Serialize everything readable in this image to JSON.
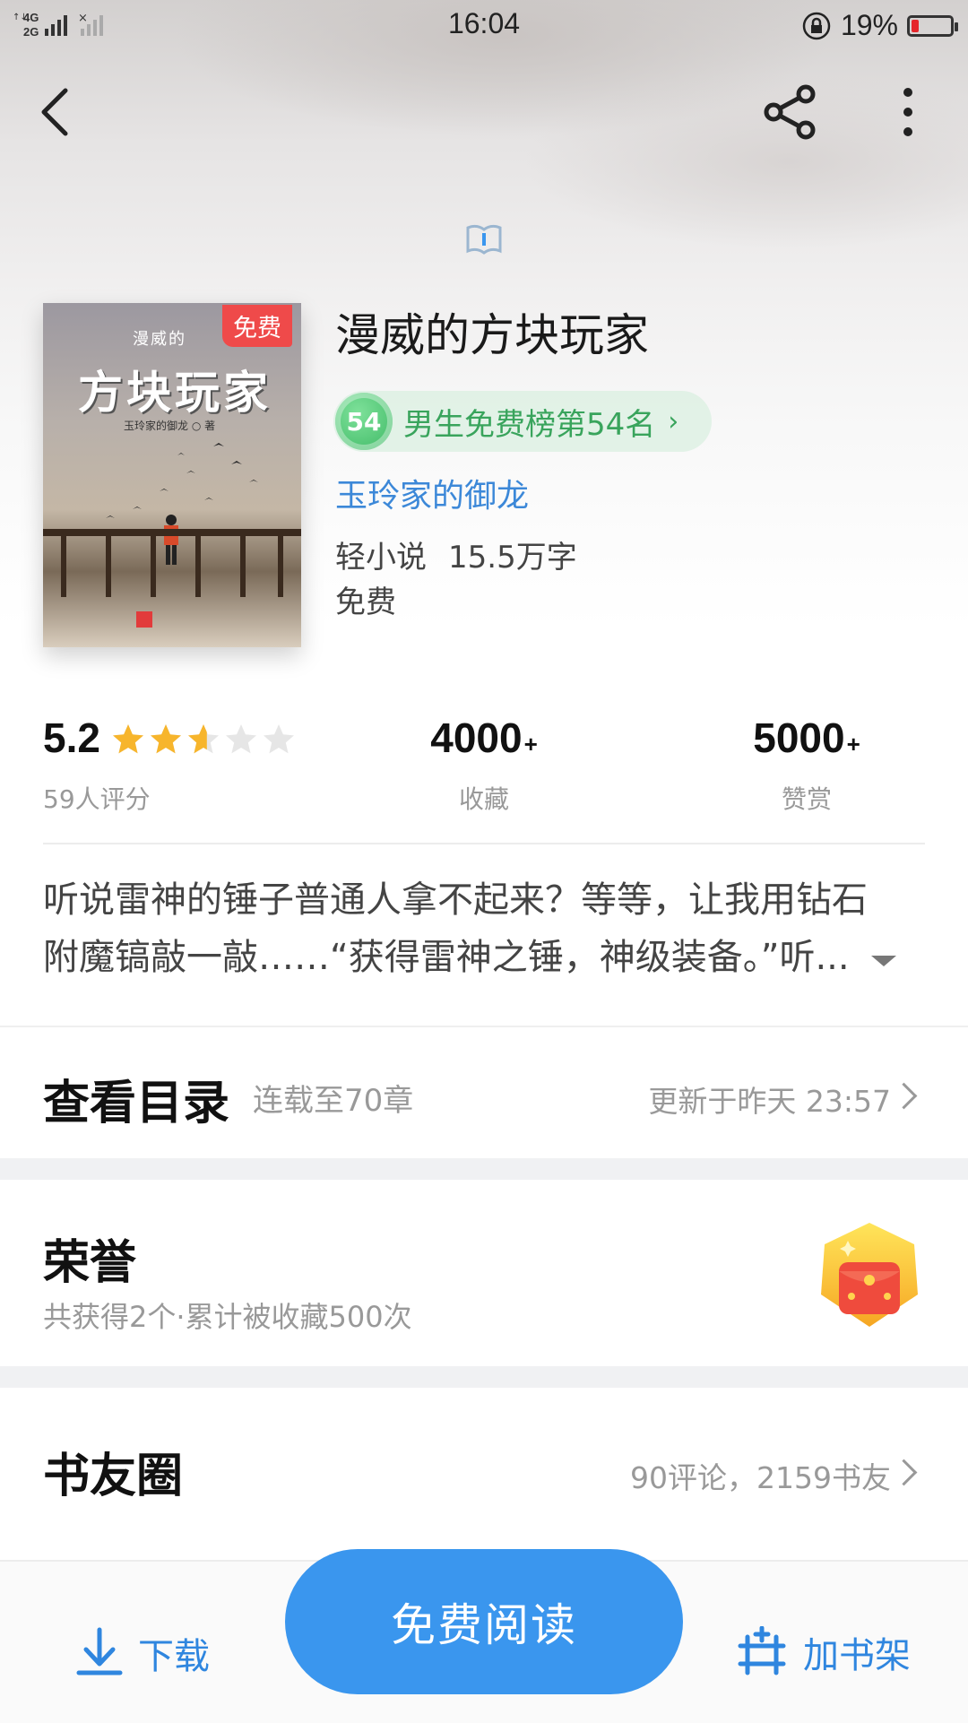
{
  "status_bar": {
    "network": "4G 2G",
    "time": "16:04",
    "battery_percent": "19%",
    "battery_level": 0.19,
    "battery_color": "#e5262b"
  },
  "nav": {
    "back_icon": "back-arrow-icon",
    "share_icon": "share-icon",
    "more_icon": "more-vertical-icon"
  },
  "book": {
    "title": "漫威的方块玩家",
    "cover": {
      "badge": "免费",
      "small_text": "漫威的",
      "big_title": "方块玩家",
      "author_line": "玉玲家的御龙 ○ 著"
    },
    "rank": {
      "number": "54",
      "label": "男生免费榜第54名",
      "arrow": "›",
      "color": "#39a45c"
    },
    "author": "玉玲家的御龙",
    "category": "轻小说",
    "word_count": "15.5万字",
    "price": "免费"
  },
  "stats": {
    "rating": "5.2",
    "rating_stars": 2.6,
    "rating_max_stars": 5,
    "rating_count": "59人评分",
    "favorites_value": "4000",
    "favorites_suffix": "+",
    "favorites_label": "收藏",
    "rewards_value": "5000",
    "rewards_suffix": "+",
    "rewards_label": "赞赏",
    "star_color": "#f7b52c"
  },
  "intro": {
    "line1": "听说雷神的锤子普通人拿不起来？等等，让我用钻石",
    "line2": "附魔镐敲一敲……“获得雷神之锤，神级装备。”听..."
  },
  "catalog": {
    "title": "查看目录",
    "subtitle": "连载至70章",
    "updated": "更新于昨天 23:57"
  },
  "honor": {
    "title": "荣誉",
    "subtitle": "共获得2个·累计被收藏500次"
  },
  "community": {
    "title": "书友圈",
    "stats": "90评论，2159书友"
  },
  "bottom_bar": {
    "download": "下载",
    "read": "免费阅读",
    "add_shelf": "加书架",
    "accent": "#2f86df"
  }
}
